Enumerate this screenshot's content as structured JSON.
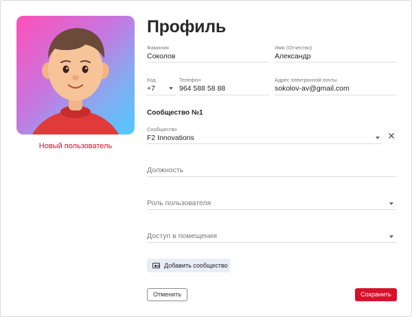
{
  "profile": {
    "title": "Профиль",
    "new_user_label": "Новый пользователь"
  },
  "fields": {
    "last_name": {
      "label": "Фамилия",
      "value": "Соколов"
    },
    "first_name": {
      "label": "Имя (Отчество)",
      "value": "Александр"
    },
    "code": {
      "label": "Код",
      "value": "+7"
    },
    "phone": {
      "label": "Телефон",
      "value": "964 588 58 88"
    },
    "email": {
      "label": "Адрес электронной почты",
      "value": "sokolov-av@gmail.com"
    }
  },
  "community": {
    "section_title": "Сообщество №1",
    "label": "Сообщество",
    "value": "F2 Innovations",
    "position_placeholder": "Должность",
    "role_placeholder": "Роль пользователя",
    "access_placeholder": "Доступ в помещения"
  },
  "buttons": {
    "add_community": "Добавить сообщество",
    "cancel": "Отменить",
    "save": "Сохранить"
  },
  "colors": {
    "accent": "#d9102c",
    "button_secondary_bg": "#e8eef7"
  },
  "icons": {
    "close": "close-icon",
    "dropdown": "chevron-down-icon",
    "add_community": "id-card-icon"
  }
}
